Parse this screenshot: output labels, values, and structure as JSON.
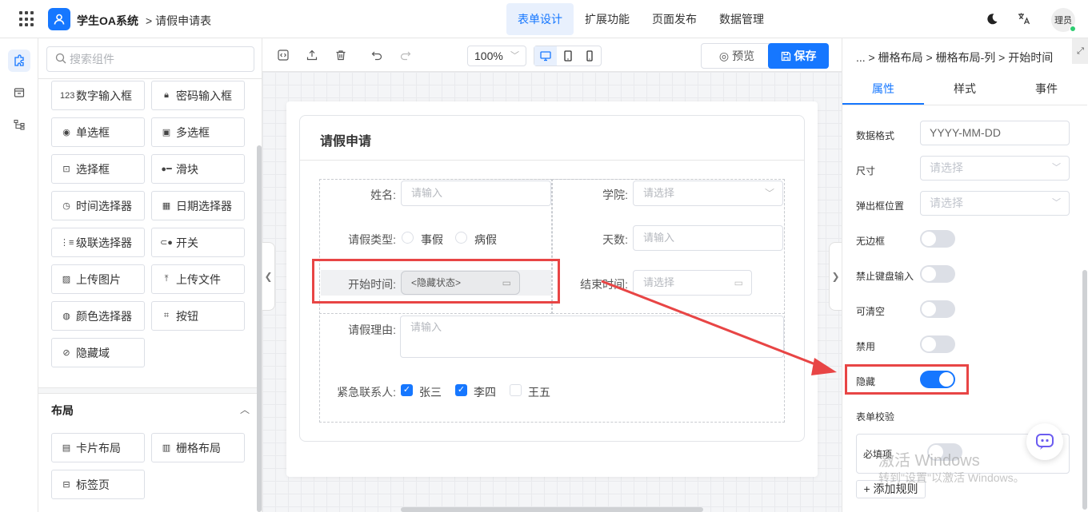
{
  "header": {
    "app_title": "学生OA系统",
    "breadcrumb": "> 请假申请表",
    "tabs": [
      "表单设计",
      "扩展功能",
      "页面发布",
      "数据管理"
    ],
    "active_tab": "表单设计",
    "avatar_text": "理员"
  },
  "sidebar": {
    "search_placeholder": "搜索组件",
    "components": [
      "数字输入框",
      "密码输入框",
      "单选框",
      "多选框",
      "选择框",
      "滑块",
      "时间选择器",
      "日期选择器",
      "级联选择器",
      "开关",
      "上传图片",
      "上传文件",
      "颜色选择器",
      "按钮",
      "隐藏域"
    ],
    "layout_section_title": "布局",
    "layout_components": [
      "卡片布局",
      "栅格布局",
      "标签页"
    ]
  },
  "toolbar": {
    "zoom": "100%",
    "preview_label": "预览",
    "save_label": "保存"
  },
  "form": {
    "card_title": "请假申请",
    "fields": {
      "name_label": "姓名:",
      "name_placeholder": "请输入",
      "college_label": "学院:",
      "college_placeholder": "请选择",
      "leave_type_label": "请假类型:",
      "leave_type_options": [
        "事假",
        "病假"
      ],
      "days_label": "天数:",
      "days_placeholder": "请输入",
      "start_label": "开始时间:",
      "start_value": "<隐藏状态>",
      "end_label": "结束时间:",
      "end_placeholder": "请选择",
      "reason_label": "请假理由:",
      "reason_placeholder": "请输入",
      "contact_label": "紧急联系人:",
      "contact_options": [
        {
          "label": "张三",
          "checked": true
        },
        {
          "label": "李四",
          "checked": true
        },
        {
          "label": "王五",
          "checked": false
        }
      ]
    }
  },
  "properties": {
    "breadcrumb": "... > 栅格布局 > 栅格布局-列 > 开始时间",
    "tabs": [
      "属性",
      "样式",
      "事件"
    ],
    "active_tab": "属性",
    "data_format_label": "数据格式",
    "data_format_value": "YYYY-MM-DD",
    "size_label": "尺寸",
    "size_placeholder": "请选择",
    "popup_position_label": "弹出框位置",
    "popup_position_placeholder": "请选择",
    "toggles": [
      {
        "label": "无边框",
        "on": false
      },
      {
        "label": "禁止键盘输入",
        "on": false
      },
      {
        "label": "可清空",
        "on": false
      },
      {
        "label": "禁用",
        "on": false
      },
      {
        "label": "隐藏",
        "on": true
      }
    ],
    "validation_label": "表单校验",
    "required_label": "必填项",
    "required_on": false,
    "add_rule_label": "+ 添加规则"
  },
  "watermark": {
    "line1": "激活 Windows",
    "line2": "转到\"设置\"以激活 Windows。"
  },
  "colors": {
    "accent": "#1677ff",
    "annotation": "#e84545"
  }
}
